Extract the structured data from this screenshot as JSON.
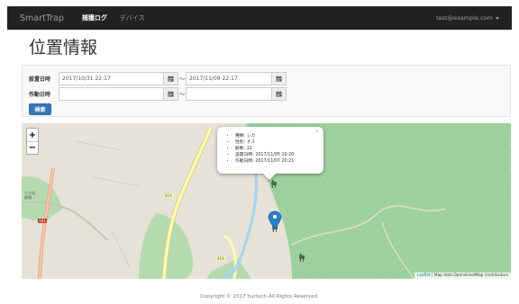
{
  "navbar": {
    "brand": "SmartTrap",
    "items": [
      {
        "label": "捕獲ログ",
        "active": true
      },
      {
        "label": "デバイス",
        "active": false
      }
    ],
    "user": "test@example.com"
  },
  "page_title": "位置情報",
  "search": {
    "row1": {
      "label": "設置日時",
      "from": "2017/10/31 22:17",
      "separator": "〜",
      "to": "2017/11/09 22:17"
    },
    "row2": {
      "label": "作動日時",
      "from": "",
      "separator": "〜",
      "to": ""
    },
    "button": "検索"
  },
  "map": {
    "zoom_in": "+",
    "zoom_out": "−",
    "popup": {
      "close": "×",
      "lines": [
        "種類: シカ",
        "性別: オス",
        "齢数: 12",
        "設置日時: 2017/11/05 10:20",
        "作動日時: 2017/11/07 20:21"
      ]
    },
    "labels": {
      "road_619_a": "619",
      "road_619_b": "619",
      "road_141": "141",
      "place": "たかね\n根場"
    },
    "attribution": {
      "leaflet": "Leaflet",
      "sep": " | ",
      "text": "Map data OpenstreetMap contributors"
    },
    "colors": {
      "forest": "#9fd1a0",
      "land": "#e6e2d8",
      "road": "#fdfbb0",
      "river": "#a8d4f1",
      "marker": "#2a81cb"
    }
  },
  "footer": "Copyright © 2017 hurtech All Rights Reserved."
}
